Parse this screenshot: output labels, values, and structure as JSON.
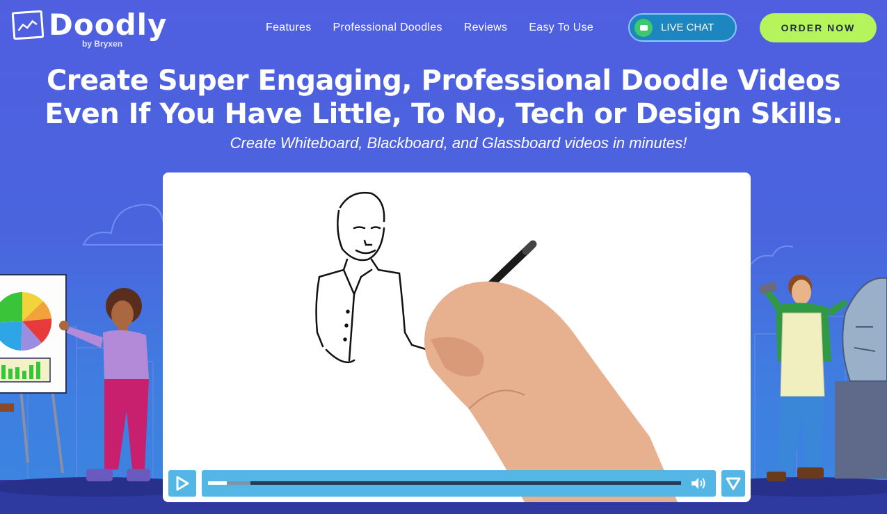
{
  "brand": {
    "name": "Doodly",
    "byline": "by Bryxen"
  },
  "nav": {
    "items": [
      {
        "label": "Features"
      },
      {
        "label": "Professional Doodles"
      },
      {
        "label": "Reviews"
      },
      {
        "label": "Easy To Use"
      }
    ],
    "live_chat_label": "LIVE CHAT",
    "order_label": "ORDER NOW"
  },
  "hero": {
    "headline_line1": "Create Super Engaging, Professional Doodle Videos",
    "headline_line2": "Even If You Have Little, To No, Tech or Design Skills.",
    "subheadline": "Create Whiteboard, Blackboard, and Glassboard videos in minutes!"
  },
  "video_player": {
    "progress_played": 0.04,
    "progress_buffered": 0.09,
    "icons": [
      "play-icon",
      "volume-icon",
      "vimeo-icon"
    ]
  },
  "colors": {
    "background": "#4a64de",
    "order_button": "#b5f55b",
    "live_chat_button": "#1d86c0",
    "chat_icon": "#3cc86d",
    "player_controls": "#54b6e4"
  }
}
